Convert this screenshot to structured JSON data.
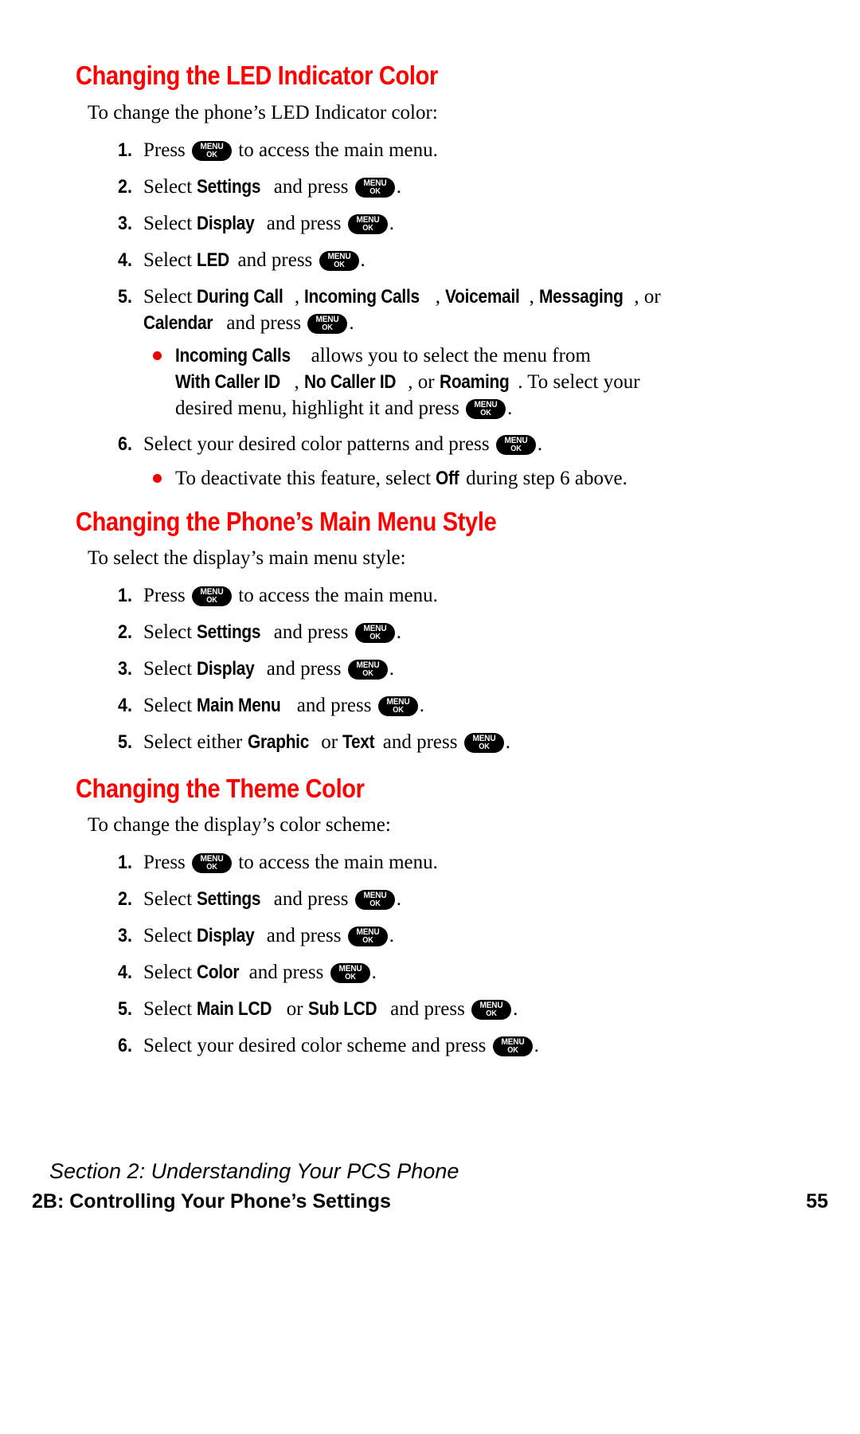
{
  "page": {
    "number": "55",
    "accent_color": "#ff0000",
    "bullet_color": "#ee0000",
    "key_glyph": {
      "line1": "MENU",
      "line2": "OK"
    }
  },
  "sections": [
    {
      "heading": "Changing the LED Indicator Color",
      "intro": "To change the phone’s LED Indicator color:",
      "steps": [
        {
          "num": "1.",
          "pre": "Press ",
          "post": " to access the main menu."
        },
        {
          "num": "2.",
          "pre": "Select ",
          "term": "Settings",
          "mid": " and press ",
          "post": "."
        },
        {
          "num": "3.",
          "pre": "Select ",
          "term": "Display",
          "mid": " and press ",
          "post": "."
        },
        {
          "num": "4.",
          "pre": "Select ",
          "term": "LED",
          "mid": " and press ",
          "post": "."
        },
        {
          "num": "5.",
          "pre": "Select ",
          "terms": [
            "During Call",
            "Incoming Calls",
            "Voicemail",
            "Messaging"
          ],
          "sep": ", ",
          "conj": ", or ",
          "last_term": "Calendar",
          "mid": " and press ",
          "post": "."
        },
        {
          "num": "6.",
          "pre": "Select your desired color patterns and press ",
          "post": "."
        }
      ],
      "bullets": [
        {
          "after_step": "5",
          "lead_term": "Incoming Calls",
          "text1": " allows you to select the menu from ",
          "terms": [
            "With Caller ID",
            "No Caller ID",
            "Roaming"
          ],
          "text2": ". To select your desired menu, highlight it and press ",
          "text3": "."
        },
        {
          "after_step": "6",
          "text1": "To deactivate this feature, select ",
          "term": "Off",
          "text2": " during step 6 above."
        }
      ]
    },
    {
      "heading": "Changing the Phone’s Main Menu Style",
      "intro": "To select the display’s main menu style:",
      "steps": [
        {
          "num": "1.",
          "pre": "Press ",
          "post": " to access the main menu."
        },
        {
          "num": "2.",
          "pre": "Select ",
          "term": "Settings",
          "mid": " and press ",
          "post": "."
        },
        {
          "num": "3.",
          "pre": "Select ",
          "term": "Display",
          "mid": " and press ",
          "post": "."
        },
        {
          "num": "4.",
          "pre": "Select ",
          "term": "Main Menu",
          "mid": " and press ",
          "post": "."
        },
        {
          "num": "5.",
          "pre": "Select either ",
          "term": "Graphic",
          "mid2": " or ",
          "term2": "Text",
          "mid": " and press ",
          "post": "."
        }
      ],
      "bullets": []
    },
    {
      "heading": "Changing the Theme Color",
      "intro": "To change the display’s color scheme:",
      "steps": [
        {
          "num": "1.",
          "pre": "Press ",
          "post": " to access the main menu."
        },
        {
          "num": "2.",
          "pre": "Select ",
          "term": "Settings",
          "mid": " and press ",
          "post": "."
        },
        {
          "num": "3.",
          "pre": "Select ",
          "term": "Display",
          "mid": " and press ",
          "post": "."
        },
        {
          "num": "4.",
          "pre": "Select ",
          "term": "Color",
          "mid": " and press ",
          "post": "."
        },
        {
          "num": "5.",
          "pre": "Select ",
          "term": "Main LCD",
          "mid2": " or ",
          "term2": "Sub LCD",
          "mid": " and press ",
          "post": "."
        },
        {
          "num": "6.",
          "pre": "Select your desired color scheme and press ",
          "post": "."
        }
      ],
      "bullets": []
    }
  ],
  "footer": {
    "section_label": "Section 2: Understanding Your PCS Phone",
    "chapter_label": "2B: Controlling Your Phone’s Settings",
    "page_number": "55"
  }
}
